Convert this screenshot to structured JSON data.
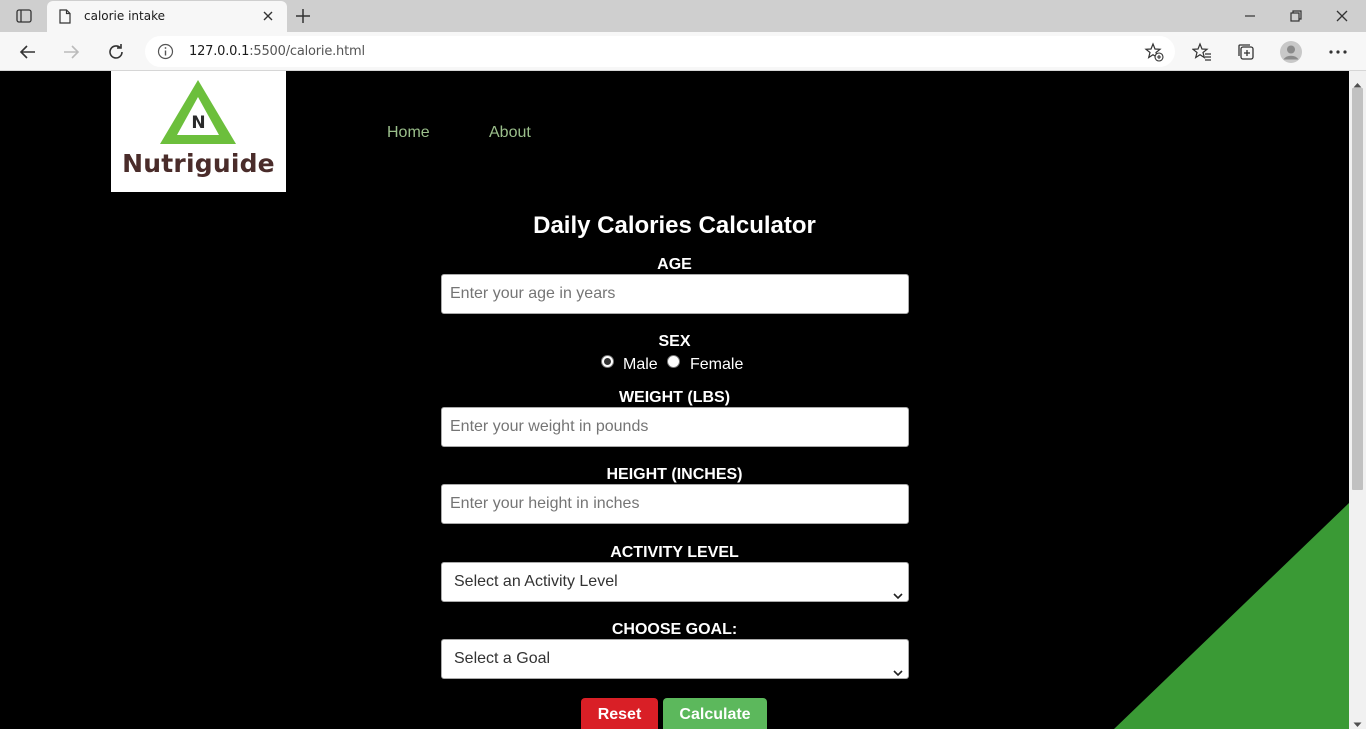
{
  "browser": {
    "tab_title": "calorie intake",
    "url_host": "127.0.0.1",
    "url_path": ":5500/calorie.html"
  },
  "site": {
    "logo_letter": "N",
    "logo_text": "Nutriguide",
    "nav": [
      "Home",
      "About"
    ],
    "brand_green": "#3a9a35",
    "nav_color": "#9bbf8b"
  },
  "form": {
    "title": "Daily Calories Calculator",
    "age_label": "AGE",
    "age_placeholder": "Enter your age in years",
    "sex_label": "SEX",
    "sex_options": [
      "Male",
      "Female"
    ],
    "sex_selected": "Male",
    "weight_label": "WEIGHT (LBS)",
    "weight_placeholder": "Enter your weight in pounds",
    "height_label": "HEIGHT (INCHES)",
    "height_placeholder": "Enter your height in inches",
    "activity_label": "ACTIVITY LEVEL",
    "activity_selected": "Select an Activity Level",
    "goal_label": "CHOOSE GOAL:",
    "goal_selected": "Select a Goal",
    "reset_label": "Reset",
    "calculate_label": "Calculate"
  }
}
